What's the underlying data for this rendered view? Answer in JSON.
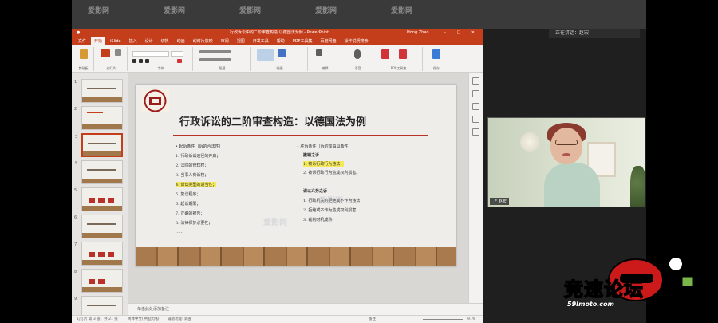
{
  "topbar": {
    "watermark": "爱影网",
    "meeting_ctrl": "正在讲话：赵宏"
  },
  "ppt": {
    "title": "行政诉讼中的二阶审查构造 以德国法为例 - PowerPoint",
    "user": "Hong Zhao",
    "window_controls": "– □ ✕",
    "tabs": [
      "文件",
      "开始",
      "iSlide",
      "插入",
      "设计",
      "切换",
      "动画",
      "幻灯片放映",
      "审阅",
      "视图",
      "开发工具",
      "帮助",
      "PDF工具集",
      "百度网盘",
      "操作说明搜索"
    ],
    "ribbon_groups": [
      "剪贴板",
      "幻灯片",
      "字体",
      "段落",
      "绘图",
      "编辑",
      "语音",
      "PDF工具集",
      "保存"
    ],
    "thumbnail_numbers": [
      "1",
      "2",
      "3",
      "4",
      "5",
      "6",
      "7",
      "8",
      "9"
    ],
    "slide": {
      "title": "行政诉讼的二阶审查构造：以德国法为例",
      "left_list": [
        "• 起诉条件（诉的合法性）",
        "1. 行政诉讼途径的开启；",
        "2. 法院的管辖权；",
        "3. 当事人有诉权；",
        "4. 诉讼类型的适当性；",
        "5. 复议程序；",
        "6. 起诉期限；",
        "7. 正确的被告；",
        "8. 法律保护必要性；",
        "……"
      ],
      "right_list": [
        "• 胜诉条件（诉的理由具备性）",
        "撤销之诉",
        "1. 被诉行政行为违法；",
        "2. 被诉行政行为造成权利损害。",
        "课以义务之诉",
        "1. 行政机关的拒绝或不作为违法；",
        "2. 拒绝或不作为造成权利损害；",
        "3. 裁判时机成熟"
      ]
    },
    "notes_placeholder": "单击此处添加备注",
    "status": {
      "slide_count": "幻灯片 第 3 张，共 21 张",
      "language": "简体中文(中国大陆)",
      "accessibility": "辅助功能: 调查",
      "notes_btn": "备注",
      "zoom": "91%"
    }
  },
  "video": {
    "participant_name": "赵宏"
  },
  "watermark": {
    "brand": "竞速论坛",
    "sub": "59Imoto.com"
  },
  "colors": {
    "ppt_accent": "#c43e1c",
    "highlight": "#f4e95a",
    "slide_redline": "#b8322a"
  }
}
